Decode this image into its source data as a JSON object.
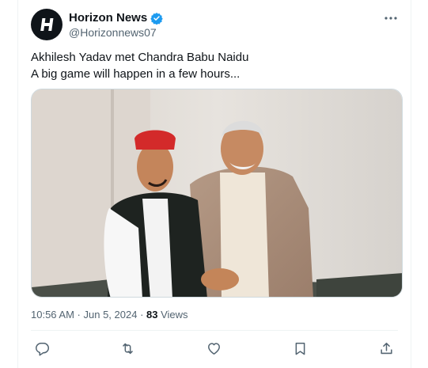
{
  "tweet": {
    "author": {
      "name": "Horizon News",
      "handle": "@Horizonnews07",
      "avatar_icon": "horizon-logo-h",
      "verified_color": "#1d9bf0"
    },
    "text_lines": [
      "Akhilesh Yadav met Chandra Babu Naidu",
      "A big game will happen in a few hours..."
    ],
    "media": {
      "type": "photo"
    },
    "meta": {
      "time": "10:56 AM",
      "separator1": " · ",
      "date": "Jun 5, 2024",
      "separator2": " · ",
      "views_count": "83",
      "views_label": " Views"
    },
    "actions": [
      {
        "name": "reply",
        "icon": "reply-icon"
      },
      {
        "name": "repost",
        "icon": "repost-icon"
      },
      {
        "name": "like",
        "icon": "heart-icon"
      },
      {
        "name": "bookmark",
        "icon": "bookmark-icon"
      },
      {
        "name": "share",
        "icon": "share-icon"
      }
    ]
  },
  "colors": {
    "text": "#0f1419",
    "secondary": "#536471",
    "border": "#cfd9de",
    "verified": "#1d9bf0"
  }
}
